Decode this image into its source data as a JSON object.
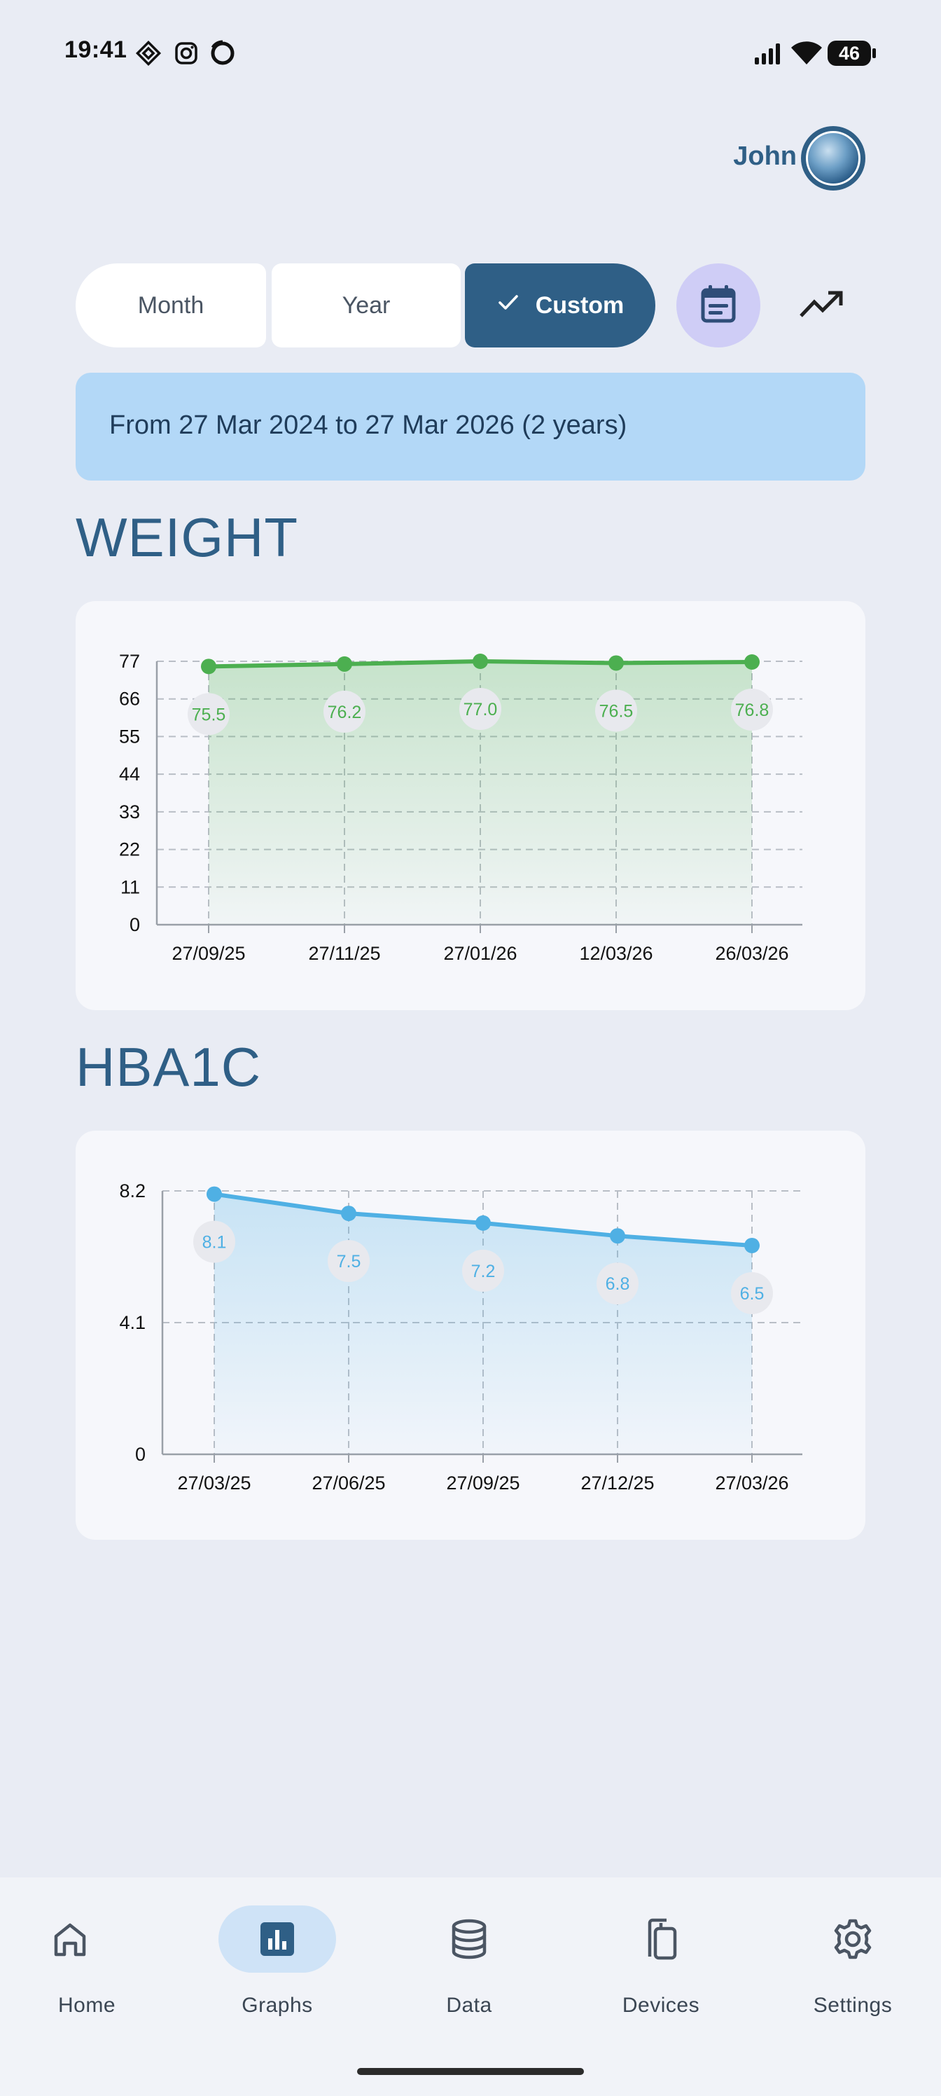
{
  "status_bar": {
    "time": "19:41",
    "battery": "46"
  },
  "header": {
    "user_name": "John"
  },
  "range_tabs": [
    {
      "label": "Month",
      "selected": false
    },
    {
      "label": "Year",
      "selected": false
    },
    {
      "label": "Custom",
      "selected": true
    }
  ],
  "icons": {
    "calendar": "calendar-icon",
    "trend": "trending-up-icon",
    "check": "check-icon"
  },
  "range_banner": {
    "text": "From 27 Mar 2024 to 27 Mar 2026 (2 years)"
  },
  "sections": {
    "weight_title": "WEIGHT",
    "hba1c_title": "HBA1C"
  },
  "chart_data": [
    {
      "type": "area",
      "title": "WEIGHT",
      "categories": [
        "27/09/25",
        "27/11/25",
        "27/01/26",
        "12/03/26",
        "26/03/26"
      ],
      "series": [
        {
          "values": [
            75.5,
            76.2,
            77.0,
            76.5,
            76.8
          ]
        }
      ],
      "value_labels": [
        "75.5",
        "76.2",
        "77.0",
        "76.5",
        "76.8"
      ],
      "yticks": [
        "0",
        "11",
        "22",
        "33",
        "44",
        "55",
        "66",
        "77"
      ],
      "ylim": [
        0,
        77
      ],
      "grid": true,
      "color": "#4caf50"
    },
    {
      "type": "area",
      "title": "HBA1C",
      "categories": [
        "27/03/25",
        "27/06/25",
        "27/09/25",
        "27/12/25",
        "27/03/26"
      ],
      "series": [
        {
          "values": [
            8.1,
            7.5,
            7.2,
            6.8,
            6.5
          ]
        }
      ],
      "value_labels": [
        "8.1",
        "7.5",
        "7.2",
        "6.8",
        "6.5"
      ],
      "yticks": [
        "0",
        "4.1",
        "8.2"
      ],
      "ylim": [
        0,
        8.2
      ],
      "grid": true,
      "color": "#4fb0e4"
    }
  ],
  "nav": [
    {
      "label": "Home",
      "icon": "home-icon",
      "active": false
    },
    {
      "label": "Graphs",
      "icon": "bar-chart-icon",
      "active": true
    },
    {
      "label": "Data",
      "icon": "database-icon",
      "active": false
    },
    {
      "label": "Devices",
      "icon": "devices-icon",
      "active": false
    },
    {
      "label": "Settings",
      "icon": "gear-icon",
      "active": false
    }
  ]
}
